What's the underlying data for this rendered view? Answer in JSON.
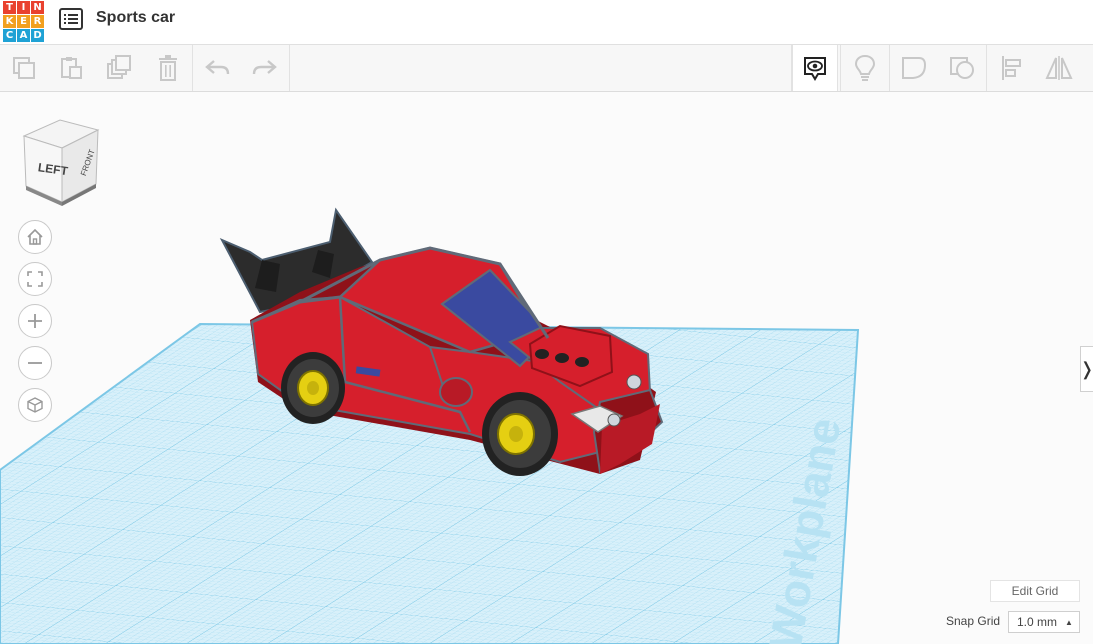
{
  "header": {
    "logo_letters": [
      "T",
      "I",
      "N",
      "K",
      "E",
      "R",
      "C",
      "A",
      "D"
    ],
    "logo_colors": [
      "#e9412e",
      "#e9412e",
      "#e9412e",
      "#f2a01f",
      "#f2a01f",
      "#f2a01f",
      "#1fa2d5",
      "#1fa2d5",
      "#1fa2d5"
    ],
    "title": "Sports car"
  },
  "toolbar": {
    "left_icons": [
      "copy-icon",
      "paste-icon",
      "duplicate-icon",
      "delete-icon",
      "undo-icon",
      "redo-icon"
    ],
    "right_icons": [
      "notes-visibility-icon",
      "light-bulb-icon",
      "group-icon",
      "ungroup-icon",
      "align-icon",
      "mirror-icon"
    ]
  },
  "viewcube": {
    "front_label": "LEFT",
    "side_label": "FRONT"
  },
  "nav": [
    "home-icon",
    "fit-view-icon",
    "zoom-in-icon",
    "zoom-out-icon",
    "ortho-view-icon"
  ],
  "workplane": {
    "watermark": "Workplane",
    "grid_color": "#8fd3ec"
  },
  "colors": {
    "car_body": "#d61f2c",
    "car_dark": "#8f1119",
    "window": "#3a4aa0",
    "wheel_rim": "#e5cf12",
    "spoiler": "#2c2c2c"
  },
  "edit_grid_label": "Edit Grid",
  "snap": {
    "label": "Snap Grid",
    "value": "1.0 mm"
  },
  "collapse_symbol": "❭"
}
